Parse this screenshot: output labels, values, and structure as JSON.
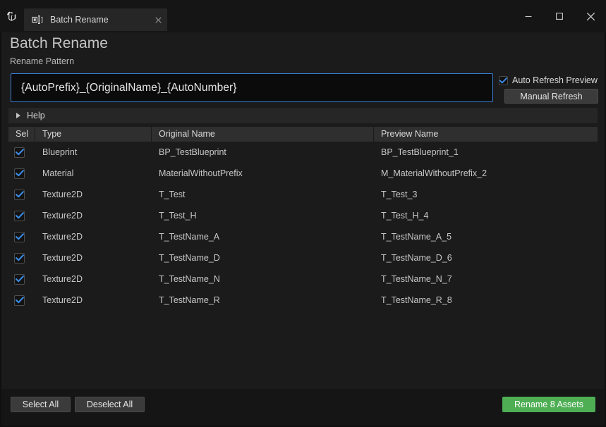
{
  "window": {
    "app_logo_icon": "unreal-engine-logo",
    "tab": {
      "icon": "rename-cursor-icon",
      "title": "Batch Rename",
      "close_icon": "close-icon"
    },
    "controls": {
      "minimize_icon": "minimize-icon",
      "maximize_icon": "maximize-icon",
      "close_icon": "close-icon"
    }
  },
  "header": {
    "page_title": "Batch Rename",
    "pattern_label": "Rename Pattern"
  },
  "pattern": {
    "value": "{AutoPrefix}_{OriginalName}_{AutoNumber}",
    "placeholder": "Rename Pattern"
  },
  "options": {
    "auto_refresh_label": "Auto Refresh Preview",
    "auto_refresh_checked": true,
    "check_icon": "check-icon",
    "manual_refresh_label": "Manual Refresh"
  },
  "help": {
    "label": "Help",
    "expander_icon": "chevron-right-icon",
    "expanded": false
  },
  "table": {
    "columns": [
      "Sel",
      "Type",
      "Original Name",
      "Preview Name"
    ],
    "rows": [
      {
        "checked": true,
        "type": "Blueprint",
        "original": "BP_TestBlueprint",
        "preview": "BP_TestBlueprint_1"
      },
      {
        "checked": true,
        "type": "Material",
        "original": "MaterialWithoutPrefix",
        "preview": "M_MaterialWithoutPrefix_2"
      },
      {
        "checked": true,
        "type": "Texture2D",
        "original": "T_Test",
        "preview": "T_Test_3"
      },
      {
        "checked": true,
        "type": "Texture2D",
        "original": "T_Test_H",
        "preview": "T_Test_H_4"
      },
      {
        "checked": true,
        "type": "Texture2D",
        "original": "T_TestName_A",
        "preview": "T_TestName_A_5"
      },
      {
        "checked": true,
        "type": "Texture2D",
        "original": "T_TestName_D",
        "preview": "T_TestName_D_6"
      },
      {
        "checked": true,
        "type": "Texture2D",
        "original": "T_TestName_N",
        "preview": "T_TestName_N_7"
      },
      {
        "checked": true,
        "type": "Texture2D",
        "original": "T_TestName_R",
        "preview": "T_TestName_R_8"
      }
    ]
  },
  "footer": {
    "select_all_label": "Select All",
    "deselect_all_label": "Deselect All",
    "rename_label": "Rename 8 Assets"
  },
  "colors": {
    "accent_blue": "#3b7fd4",
    "action_green": "#4eae54",
    "window_bg": "#151515",
    "panel_bg": "#1b1b1b",
    "header_row_bg": "#2f2f2f"
  }
}
